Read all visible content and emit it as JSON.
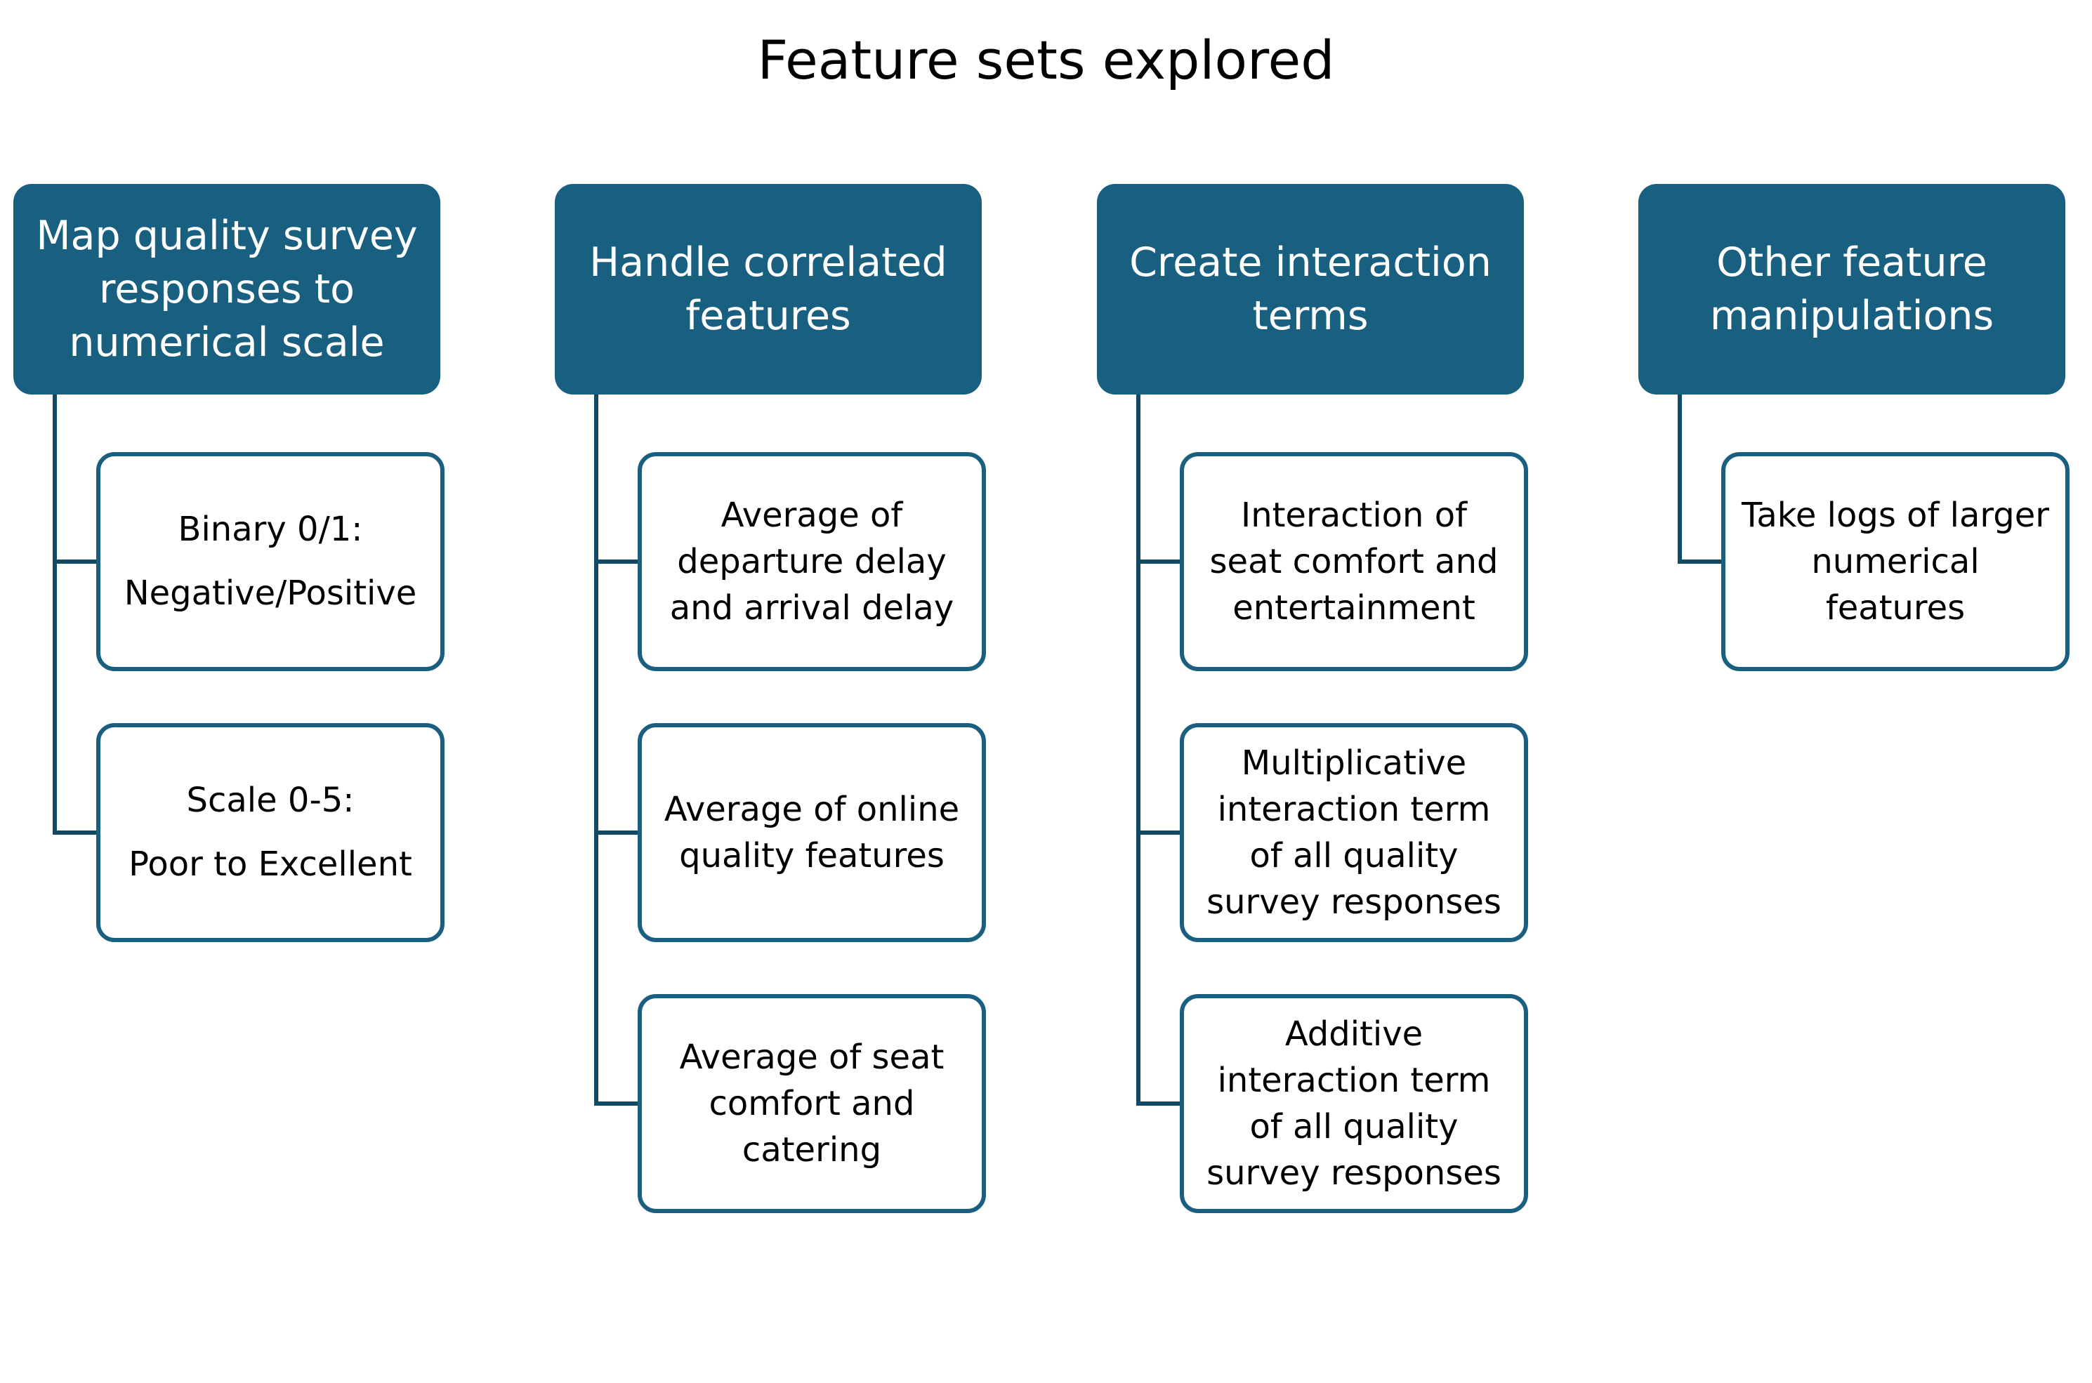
{
  "title": "Feature sets explored",
  "colors": {
    "header_fill": "#195f80",
    "box_border": "#1a5f80",
    "connector": "#124a66"
  },
  "groups": [
    {
      "header": "Map quality survey\nresponses to\nnumerical scale",
      "items": [
        "Binary 0/1:\nNegative/Positive",
        "Scale 0-5:\nPoor to Excellent"
      ]
    },
    {
      "header": "Handle correlated\nfeatures",
      "items": [
        "Average of\ndeparture delay\nand arrival delay",
        "Average of online\nquality features",
        "Average of seat\ncomfort and\ncatering"
      ]
    },
    {
      "header": "Create interaction\nterms",
      "items": [
        "Interaction of\nseat comfort and\nentertainment",
        "Multiplicative\ninteraction term\nof all quality\nsurvey responses",
        "Additive\ninteraction term\nof all quality\nsurvey responses"
      ]
    },
    {
      "header": "Other feature\nmanipulations",
      "items": [
        "Take logs of larger\nnumerical\nfeatures"
      ]
    }
  ]
}
